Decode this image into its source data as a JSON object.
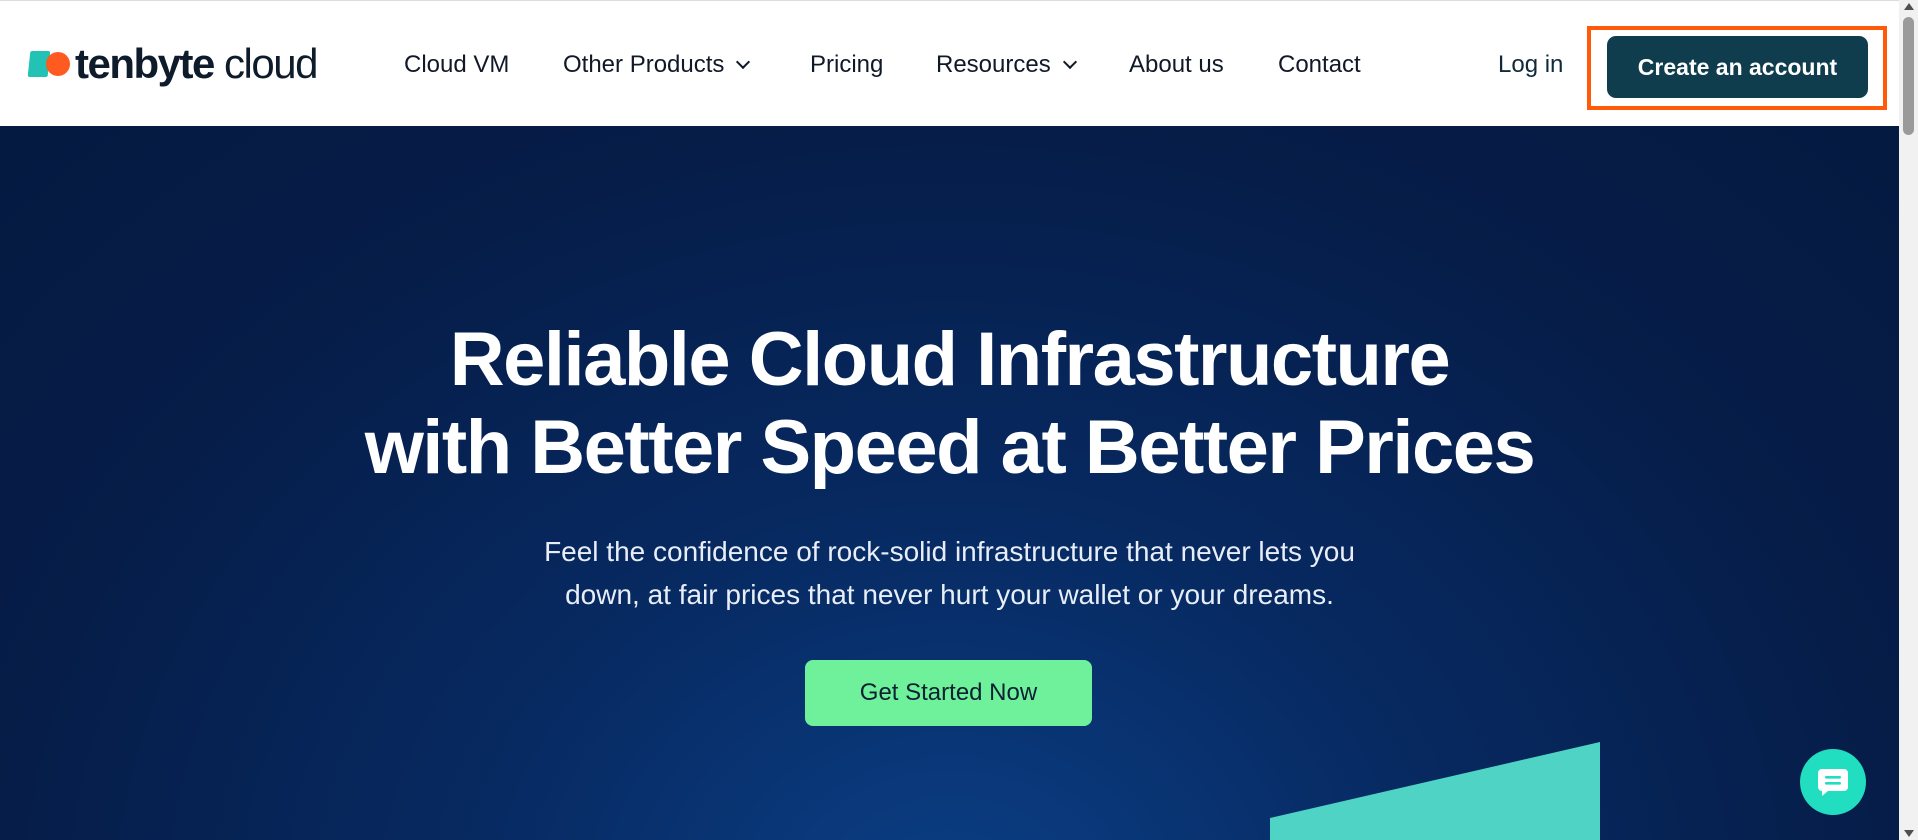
{
  "header": {
    "logo": {
      "brand_bold": "tenbyte",
      "brand_light": " cloud"
    },
    "nav": [
      {
        "label": "Cloud VM",
        "dropdown": false
      },
      {
        "label": "Other Products",
        "dropdown": true
      },
      {
        "label": "Pricing",
        "dropdown": false
      },
      {
        "label": "Resources",
        "dropdown": true
      },
      {
        "label": "About us",
        "dropdown": false
      },
      {
        "label": "Contact",
        "dropdown": false
      }
    ],
    "login_label": "Log in",
    "cta_label": "Create an account"
  },
  "hero": {
    "title_line1": "Reliable Cloud Infrastructure",
    "title_line2": "with Better Speed at Better Prices",
    "subtitle_line1": "Feel the confidence of rock-solid infrastructure that never lets you",
    "subtitle_line2": "down, at fair prices that never hurt your wallet or your dreams.",
    "button_label": "Get Started Now"
  },
  "chat": {
    "icon": "chat-bubble-icon"
  },
  "colors": {
    "cta_background": "#0f3d4e",
    "cta_highlight": "#ff5a0a",
    "hero_background": "#061d49",
    "hero_button": "#6ff09b",
    "accent_teal": "#22c3b4",
    "accent_orange": "#ff5a1f"
  }
}
